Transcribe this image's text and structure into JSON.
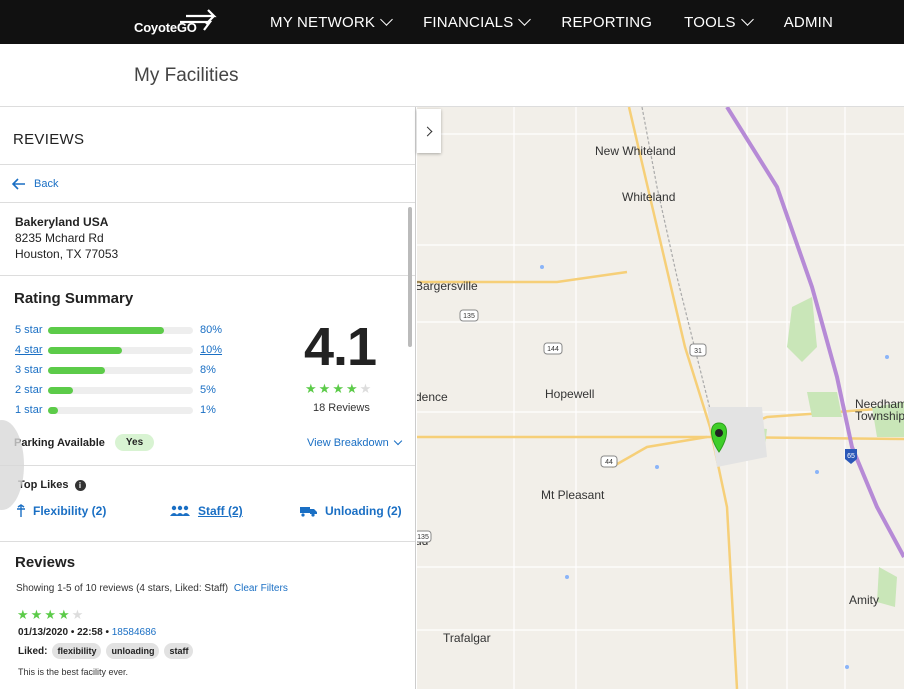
{
  "header": {
    "logo": "CoyoteGO",
    "nav": [
      {
        "label": "MY NETWORK",
        "dropdown": true
      },
      {
        "label": "FINANCIALS",
        "dropdown": true
      },
      {
        "label": "REPORTING",
        "dropdown": false
      },
      {
        "label": "TOOLS",
        "dropdown": true
      },
      {
        "label": "ADMIN",
        "dropdown": false
      }
    ]
  },
  "page": {
    "title": "My Facilities"
  },
  "panel": {
    "title": "REVIEWS",
    "back_label": "Back",
    "facility": {
      "name": "Bakeryland USA",
      "street": "8235 Mchard Rd",
      "city": "Houston, TX 77053"
    },
    "rating": {
      "title": "Rating Summary",
      "score": "4.1",
      "stars": 4,
      "review_count": "18 Reviews",
      "bars": [
        {
          "label": "5 star",
          "pct": "80%",
          "value": 0.8
        },
        {
          "label": "4 star",
          "pct": "10%",
          "value": 0.51
        },
        {
          "label": "3 star",
          "pct": "8%",
          "value": 0.39
        },
        {
          "label": "2 star",
          "pct": "5%",
          "value": 0.17
        },
        {
          "label": "1 star",
          "pct": "1%",
          "value": 0.07
        }
      ],
      "parking_label": "Parking Available",
      "parking_value": "Yes",
      "breakdown_label": "View Breakdown"
    },
    "top_likes": {
      "title": "Top Likes",
      "items": [
        {
          "label": "Flexibility (2)",
          "icon": "flexibility-icon"
        },
        {
          "label": "Staff (2)",
          "icon": "staff-icon"
        },
        {
          "label": "Unloading (2)",
          "icon": "truck-icon"
        }
      ]
    },
    "reviews": {
      "title": "Reviews",
      "showing": "Showing 1-5 of 10 reviews (4 stars, Liked: Staff)",
      "clear_filters": "Clear Filters",
      "first": {
        "stars": 4,
        "date": "01/13/2020 • 22:58 •",
        "id": "18584686",
        "liked_label": "Liked:",
        "tags": [
          "flexibility",
          "unloading",
          "staff"
        ],
        "text": "This is the best facility ever."
      }
    }
  },
  "map": {
    "places": [
      {
        "name": "New Whiteland"
      },
      {
        "name": "Whiteland"
      },
      {
        "name": "Bargersville"
      },
      {
        "name": "Hopewell"
      },
      {
        "name": "dence"
      },
      {
        "name": "Mt Pleasant"
      },
      {
        "name": "ud"
      },
      {
        "name": "Trafalgar"
      },
      {
        "name": "Amity"
      },
      {
        "name": "Needham"
      },
      {
        "name": "Township"
      }
    ],
    "route_shields": [
      "135",
      "144",
      "31",
      "44",
      "135",
      "65"
    ],
    "colors": {
      "pin": "#3fce2a",
      "interstate": "#b68ad6",
      "road": "#f6cf78",
      "green": "#c9e6b8"
    }
  }
}
